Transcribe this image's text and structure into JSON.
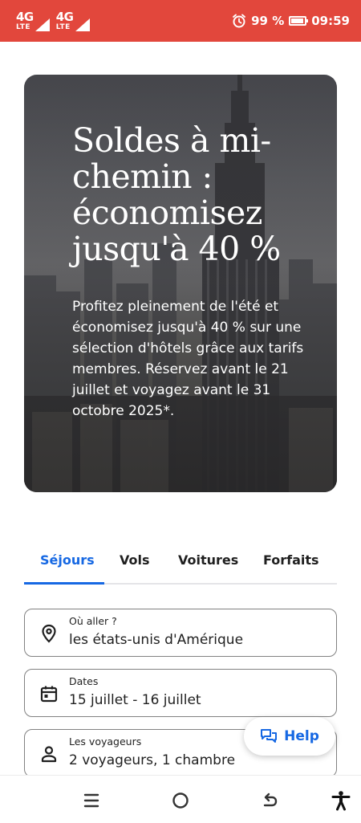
{
  "status_bar": {
    "network_1": "4G",
    "network_1_sub": "LTE",
    "network_1_tag": "4G",
    "network_2": "4G",
    "network_2_sub": "LTE",
    "battery_percent": "99 %",
    "time": "09:59",
    "icons": [
      "alarm-icon",
      "battery-icon",
      "signal-icon"
    ]
  },
  "hero": {
    "title": "Soldes à mi-chemin : économisez jusqu'à 40 %",
    "description": "Profitez pleinement de l'été et économisez jusqu'à 40 % sur une sélection d'hôtels grâce aux tarifs membres. Réservez avant le 21 juillet et voyagez avant le 31 octobre 2025*."
  },
  "tabs": [
    {
      "label": "Séjours",
      "active": true
    },
    {
      "label": "Vols",
      "active": false
    },
    {
      "label": "Voitures",
      "active": false
    },
    {
      "label": "Forfaits",
      "active": false
    }
  ],
  "search": {
    "destination": {
      "label": "Où aller ?",
      "value": "les états-unis d'Amérique",
      "icon": "location-pin-icon"
    },
    "dates": {
      "label": "Dates",
      "value": "15 juillet - 16 juillet",
      "icon": "calendar-icon"
    },
    "travellers": {
      "label": "Les voyageurs",
      "value": "2 voyageurs, 1 chambre",
      "icon": "person-icon"
    }
  },
  "help": {
    "label": "Help",
    "icon": "chat-icon"
  },
  "colors": {
    "status_bar": "#e2473c",
    "accent": "#1668e3"
  },
  "nav": [
    "menu-icon",
    "home-icon",
    "back-icon",
    "accessibility-icon"
  ]
}
